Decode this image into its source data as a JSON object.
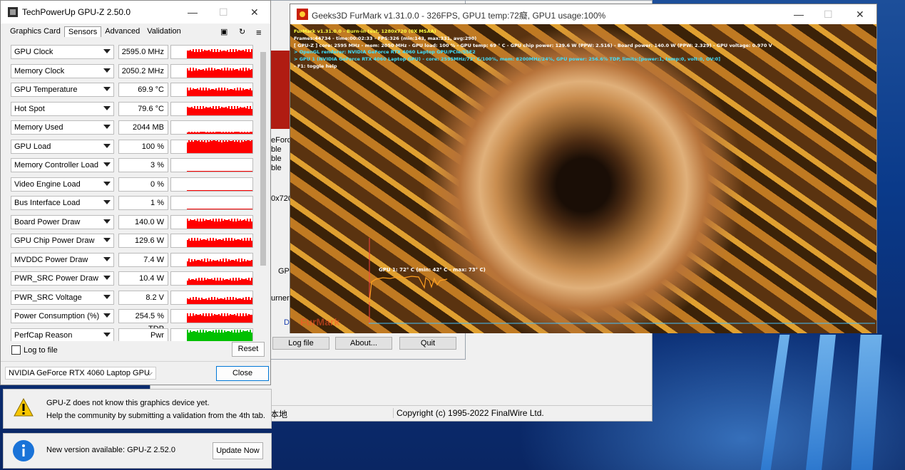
{
  "gpuz": {
    "title": "TechPowerUp GPU-Z 2.50.0",
    "tabs": [
      "Graphics Card",
      "Sensors",
      "Advanced",
      "Validation"
    ],
    "sensors": [
      {
        "name": "GPU Clock",
        "value": "2595.0 MHz",
        "fill": 0.62
      },
      {
        "name": "Memory Clock",
        "value": "2050.2 MHz",
        "fill": 0.62
      },
      {
        "name": "GPU Temperature",
        "value": "69.9 °C",
        "fill": 0.55
      },
      {
        "name": "Hot Spot",
        "value": "79.6 °C",
        "fill": 0.6
      },
      {
        "name": "Memory Used",
        "value": "2044 MB",
        "fill": 0.15
      },
      {
        "name": "GPU Load",
        "value": "100 %",
        "fill": 0.95
      },
      {
        "name": "Memory Controller Load",
        "value": "3 %",
        "fill": 0.05
      },
      {
        "name": "Video Engine Load",
        "value": "0 %",
        "fill": 0.03
      },
      {
        "name": "Bus Interface Load",
        "value": "1 %",
        "fill": 0.04
      },
      {
        "name": "Board Power Draw",
        "value": "140.0 W",
        "fill": 0.65
      },
      {
        "name": "GPU Chip Power Draw",
        "value": "129.6 W",
        "fill": 0.6
      },
      {
        "name": "MVDDC Power Draw",
        "value": "7.4 W",
        "fill": 0.45
      },
      {
        "name": "PWR_SRC Power Draw",
        "value": "10.4 W",
        "fill": 0.45
      },
      {
        "name": "PWR_SRC Voltage",
        "value": "8.2 V",
        "fill": 0.4
      },
      {
        "name": "Power Consumption (%)",
        "value": "254.5 % TDP",
        "fill": 0.62
      },
      {
        "name": "PerfCap Reason",
        "value": "Pwr",
        "fill": 0.8
      }
    ],
    "log_to_file_label": "Log to file",
    "reset_label": "Reset",
    "gpu_select": "NVIDIA GeForce RTX 4060 Laptop GPU",
    "close_label": "Close"
  },
  "notices": {
    "unknown_line1": "GPU-Z does not know this graphics device yet.",
    "unknown_line2": "Help the community by submitting a validation from the 4th tab.",
    "update_text": "New version available: GPU-Z 2.52.0",
    "update_button": "Update Now"
  },
  "aida": {
    "status_left": "本地",
    "status_right": "Copyright (c) 1995-2022 FinalWire Ltd."
  },
  "launcher": {
    "frag_eforce": "eForce",
    "frag_ble1": "ble",
    "frag_ble2": "ble",
    "frag_ble3": "ble",
    "frag_res": "0x720",
    "frag_gpu": "GPU",
    "frag_urner": "urner",
    "frag_do": "Do",
    "log_file": "Log file",
    "about": "About...",
    "quit": "Quit"
  },
  "furmark": {
    "title": "Geeks3D FurMark v1.31.0.0 - 326FPS, GPU1 temp:72癡, GPU1 usage:100%",
    "osd": [
      {
        "text": "FurMark v1.31.0.0 - Burn-in test, 1280x720 (0X MSAA)",
        "color": "#ffff40"
      },
      {
        "text": "Frames:44734 - time:00:02:33 - FPS:326 (min:143, max:331, avg:290)",
        "color": "#ffffff"
      },
      {
        "text": "[ GPU-Z ] core: 2595 MHz - mem: 2050 MHz - GPU load: 100 % - GPU temp: 69 ° C - GPU chip power: 129.6 W (PPW: 2.516) - Board power: 140.0 W (PPW: 2.329) - GPU voltage: 0.970 V",
        "color": "#ffffff"
      },
      {
        "text": "> OpenGL renderer: NVIDIA GeForce RTX 4060 Laptop GPU/PCIe/SSE2",
        "color": "#40e0ff"
      },
      {
        "text": "> GPU 1 (NVIDIA GeForce RTX 4060 Laptop GPU) - core: 2595MHz/72° C/100%, mem: 8200MHz/24%, GPU power: 256.6% TDP, limits:[power:1, temp:0, volt:0, OV:0]",
        "color": "#40e0ff"
      },
      {
        "text": "- F1: toggle help",
        "color": "#ffffff"
      }
    ],
    "graph_label": "GPU 1: 72° C (min: 42° C - max: 73° C)",
    "logo_text": "FurMark"
  },
  "colors": {
    "graph_red": "#ff0000",
    "graph_green": "#00c000",
    "furmark_graph": "#ffa020",
    "osd_yellow": "#ffff40",
    "osd_cyan": "#40e0ff"
  }
}
